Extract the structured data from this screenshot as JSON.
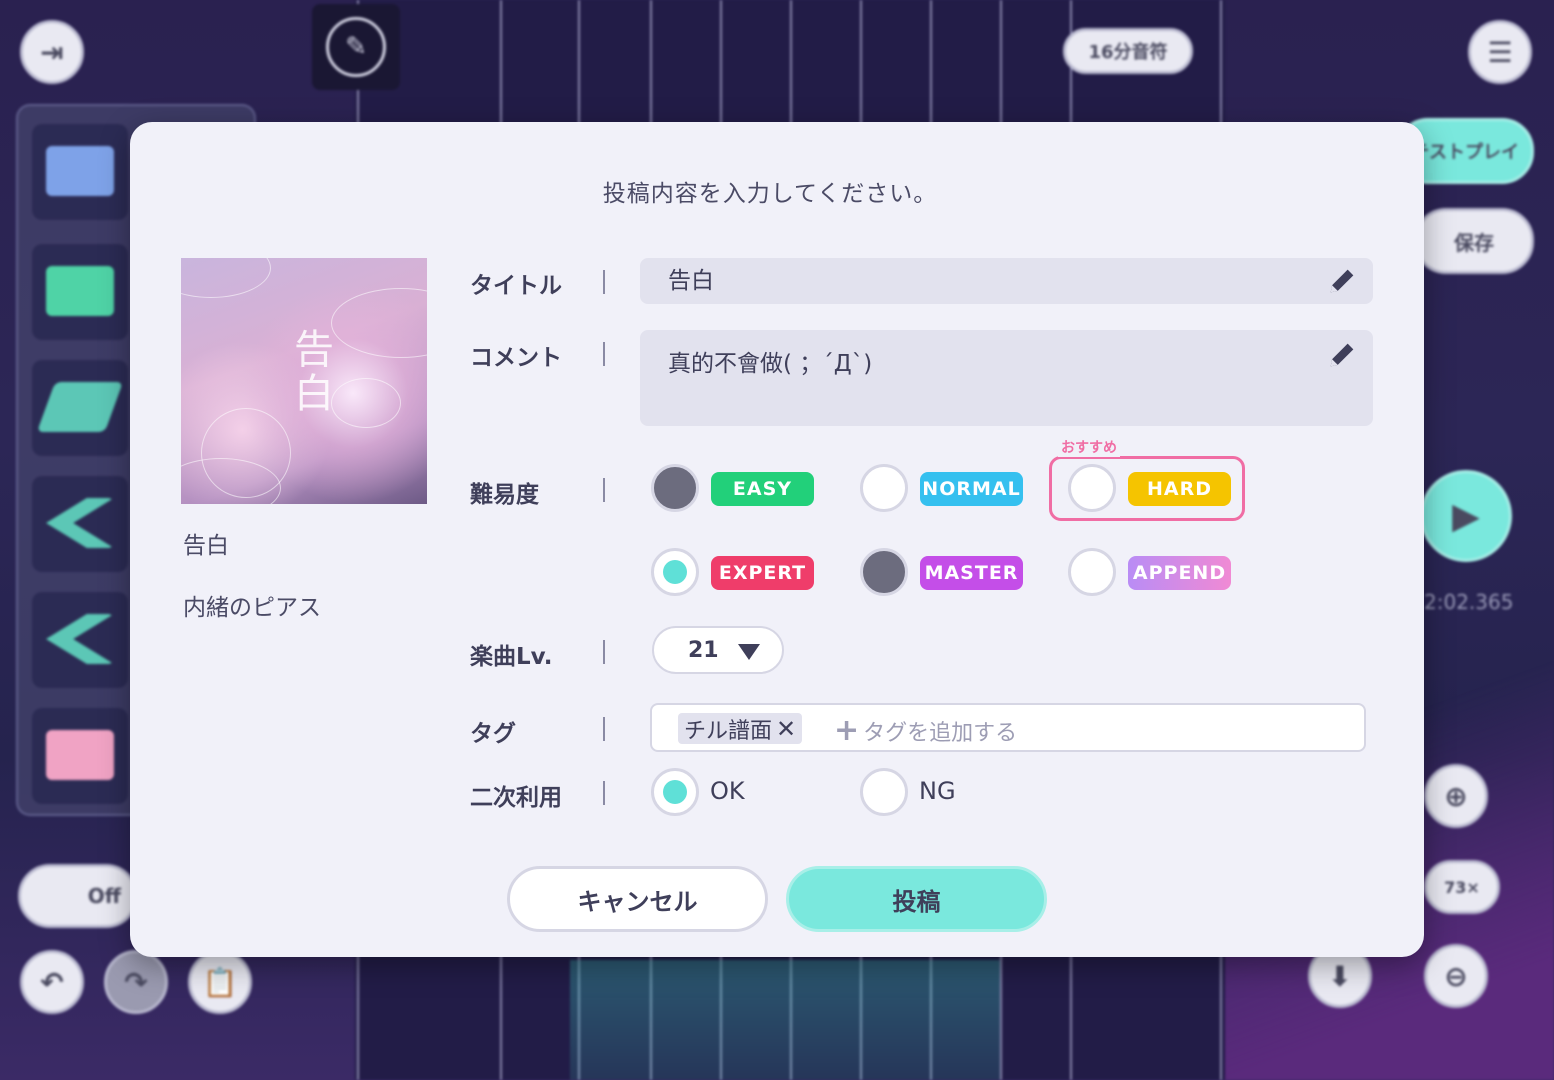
{
  "background": {
    "top_badge": "16分音符",
    "right_buttons": {
      "test_play": "テストプレイ",
      "save": "保存"
    },
    "timer": "2:02.365",
    "zoom_readout": "73×",
    "toggle_label": "Off"
  },
  "dialog": {
    "prompt": "投稿内容を入力してください。",
    "song": {
      "title": "告白",
      "artist": "内緒のピアス",
      "jacket_glyph": "告白"
    },
    "fields": {
      "title_label": "タイトル",
      "title_value": "告白",
      "comment_label": "コメント",
      "comment_value": "真的不會做( ；´Д`)",
      "difficulty_label": "難易度",
      "level_label": "楽曲Lv.",
      "level_value": "21",
      "tag_label": "タグ",
      "tags": [
        "チル譜面"
      ],
      "tag_add_placeholder": "タグを追加する",
      "secondary_use_label": "二次利用"
    },
    "difficulties": [
      {
        "name": "EASY",
        "color": "#22d07a",
        "state": "filled"
      },
      {
        "name": "NORMAL",
        "color": "#35c0ef",
        "state": "empty"
      },
      {
        "name": "HARD",
        "color": "#f5c400",
        "state": "empty",
        "recommended": true
      },
      {
        "name": "EXPERT",
        "color": "#ef3d6a",
        "state": "selected"
      },
      {
        "name": "MASTER",
        "color": "#c44ee8",
        "state": "filled"
      },
      {
        "name": "APPEND",
        "color": "#d28af0",
        "state": "empty"
      }
    ],
    "recommend_tag": "おすすめ",
    "secondary_use": {
      "ok": "OK",
      "ng": "NG",
      "selected": "OK"
    },
    "buttons": {
      "cancel": "キャンセル",
      "submit": "投稿"
    }
  },
  "colors": {
    "accent": "#5fe0d7",
    "submit_bg": "#7ae8dd",
    "recommend": "#f06da4"
  }
}
